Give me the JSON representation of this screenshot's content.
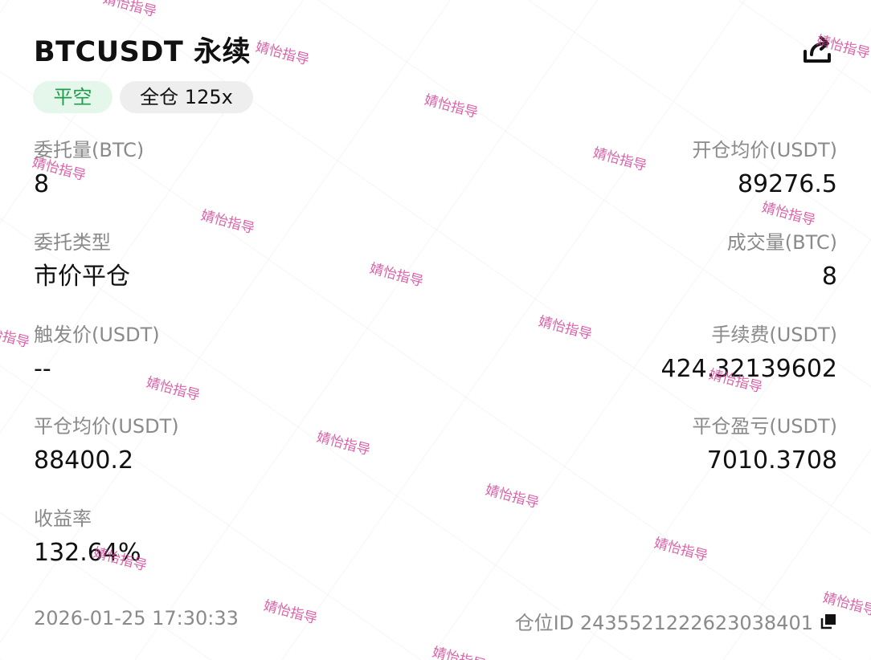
{
  "title": "BTCUSDT 永续",
  "badges": {
    "side": "平空",
    "mode": "全仓 125x"
  },
  "fields": {
    "order_qty": {
      "label": "委托量(BTC)",
      "value": "8"
    },
    "open_avg": {
      "label": "开仓均价(USDT)",
      "value": "89276.5"
    },
    "order_type": {
      "label": "委托类型",
      "value": "市价平仓"
    },
    "filled_qty": {
      "label": "成交量(BTC)",
      "value": "8"
    },
    "trigger": {
      "label": "触发价(USDT)",
      "value": "--"
    },
    "fee": {
      "label": "手续费(USDT)",
      "value": "424.32139602"
    },
    "close_avg": {
      "label": "平仓均价(USDT)",
      "value": "88400.2"
    },
    "close_pnl": {
      "label": "平仓盈亏(USDT)",
      "value": "7010.3708"
    },
    "roi": {
      "label": "收益率",
      "value": "132.64%"
    }
  },
  "footer": {
    "timestamp": "2026-01-25 17:30:33",
    "position_id": "仓位ID 2435521222623038401"
  },
  "watermark": {
    "text": "婧怡指导"
  },
  "colors": {
    "side_badge_bg": "#e5f7ea",
    "side_badge_text": "#1f9d4c",
    "label": "#8a8a8a",
    "watermark": "#d6479a"
  },
  "icons": {
    "share": "share-icon",
    "copy": "copy-icon"
  }
}
